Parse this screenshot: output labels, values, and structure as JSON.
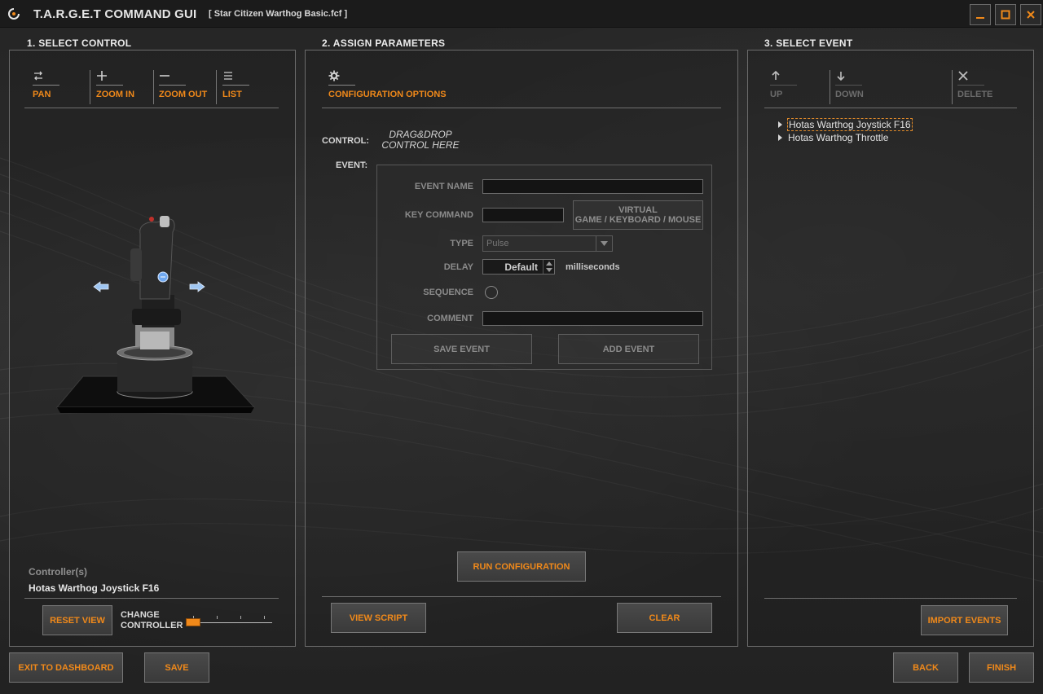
{
  "window": {
    "app_title": "T.A.R.G.E.T COMMAND GUI",
    "file_name": "[ Star Citizen Warthog Basic.fcf ]",
    "controls": [
      "minimize-icon",
      "maximize-icon",
      "close-icon"
    ]
  },
  "sections": {
    "select_control": "1. SELECT CONTROL",
    "assign_parameters": "2. ASSIGN PARAMETERS",
    "select_event": "3. SELECT EVENT"
  },
  "control_toolbar": {
    "pan": "PAN",
    "zoom_in": "ZOOM IN",
    "zoom_out": "ZOOM OUT",
    "list": "LIST"
  },
  "controller": {
    "heading": "Controller(s)",
    "name": "Hotas Warthog Joystick F16",
    "reset_view": "RESET VIEW",
    "change_controller": "CHANGE\nCONTROLLER",
    "change_controller_line1": "CHANGE",
    "change_controller_line2": "CONTROLLER"
  },
  "parameters": {
    "config_options": "CONFIGURATION OPTIONS",
    "control_label": "CONTROL:",
    "drag_drop_line1": "DRAG&DROP",
    "drag_drop_line2": "CONTROL HERE",
    "event_label": "EVENT:",
    "event_name_label": "EVENT NAME",
    "event_name_value": "",
    "key_command_label": "KEY COMMAND",
    "key_command_value": "",
    "virtual_line1": "VIRTUAL",
    "virtual_line2": "GAME / KEYBOARD / MOUSE",
    "type_label": "TYPE",
    "type_value": "Pulse",
    "delay_label": "DELAY",
    "delay_value": "Default",
    "delay_unit": "milliseconds",
    "sequence_label": "SEQUENCE",
    "comment_label": "COMMENT",
    "comment_value": "",
    "save_event": "SAVE EVENT",
    "add_event": "ADD EVENT",
    "run_configuration": "RUN CONFIGURATION",
    "view_script": "VIEW SCRIPT",
    "clear": "CLEAR"
  },
  "event_toolbar": {
    "up": "UP",
    "down": "DOWN",
    "delete": "DELETE"
  },
  "event_tree": [
    {
      "label": "Hotas Warthog Joystick F16",
      "selected": true
    },
    {
      "label": "Hotas Warthog Throttle",
      "selected": false
    }
  ],
  "import_events": "IMPORT EVENTS",
  "footer": {
    "exit_to_dashboard": "EXIT TO DASHBOARD",
    "save": "SAVE",
    "back": "BACK",
    "finish": "FINISH"
  },
  "colors": {
    "accent": "#f0891a",
    "background": "#202020",
    "panel_border": "#6b6b6b"
  }
}
